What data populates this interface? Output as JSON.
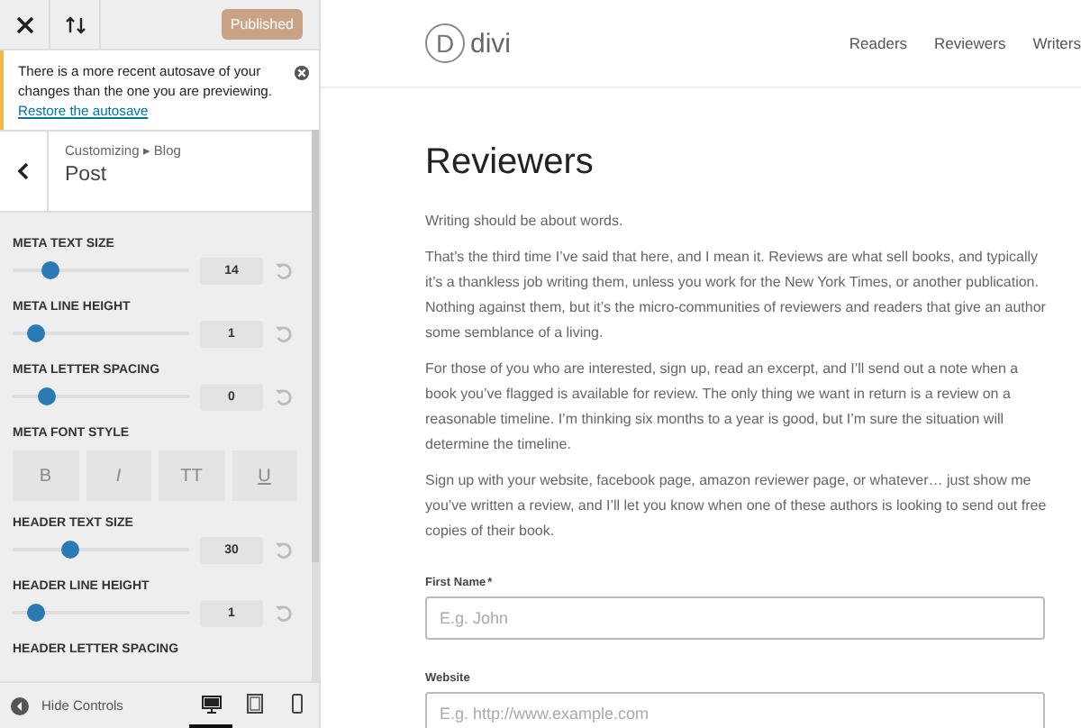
{
  "topbar": {
    "publish_button": "Published"
  },
  "notice": {
    "text": "There is a more recent autosave of your changes than the one you are previewing.",
    "link": "Restore the autosave"
  },
  "section": {
    "breadcrumb": "Customizing ▸ Blog",
    "title": "Post"
  },
  "controls": [
    {
      "kind": "slider",
      "label": "META TEXT SIZE",
      "level": 0.21,
      "value": "14"
    },
    {
      "kind": "slider",
      "label": "META LINE HEIGHT",
      "level": 0.13,
      "value": "1"
    },
    {
      "kind": "slider",
      "label": "META LETTER SPACING",
      "level": 0.19,
      "value": "0"
    },
    {
      "kind": "font_style",
      "label": "META FONT STYLE",
      "options": [
        {
          "kind": "bold",
          "text": "B",
          "selected": false
        },
        {
          "kind": "italic",
          "text": "I",
          "selected": false
        },
        {
          "kind": "caps",
          "text": "TT",
          "selected": false
        },
        {
          "kind": "underline",
          "text": "U",
          "selected": false
        }
      ]
    },
    {
      "kind": "slider",
      "label": "HEADER TEXT SIZE",
      "level": 0.33,
      "value": "30"
    },
    {
      "kind": "slider",
      "label": "HEADER LINE HEIGHT",
      "level": 0.13,
      "value": "1"
    },
    {
      "kind": "label_only",
      "label": "HEADER LETTER SPACING"
    }
  ],
  "bottom_bar": {
    "hide_controls": "Hide Controls",
    "devices": [
      {
        "kind": "desktop",
        "selected": true
      },
      {
        "kind": "tablet",
        "selected": false
      },
      {
        "kind": "mobile",
        "selected": false
      }
    ]
  },
  "preview": {
    "logo_text": "divi",
    "logo_letter": "D",
    "nav": [
      "Readers",
      "Reviewers",
      "Writers"
    ],
    "heading": "Reviewers",
    "paragraphs": [
      "Writing should be about words.",
      "That’s the third time I’ve said that here, and I mean it. Reviews are what sell books, and typically it’s a thankless job writing them, unless you work for the New York Times, or another publication. Nothing against them, but it’s the micro-communities of reviewers and readers that give an author some semblance of a living.",
      "For those of you who are interested, sign up, read an excerpt, and I’ll send out a note when a book you’ve flagged is available for review. The only thing we want in return is a review on a reasonable timeline. I’m thinking six months to a year is good, but I’m sure the situation will determine the timeline.",
      "Sign up with your website, facebook page, amazon reviewer page, or whatever… just show me you’ve written a review, and I’ll let you know when one of these authors is looking to send out free copies of their book."
    ],
    "form": [
      {
        "label": "First Name",
        "required_mark": "*",
        "placeholder": "E.g. John"
      },
      {
        "label": "Website",
        "placeholder": "E.g. http://www.example.com"
      }
    ]
  }
}
